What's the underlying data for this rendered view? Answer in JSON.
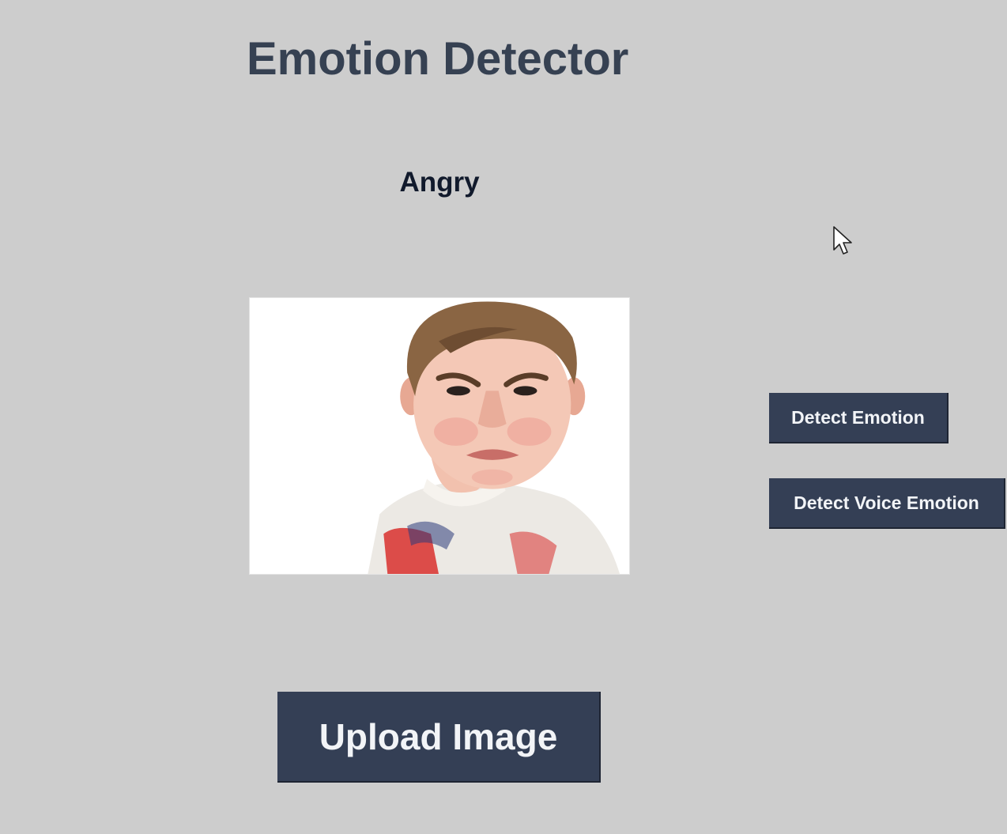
{
  "app": {
    "title": "Emotion Detector"
  },
  "result": {
    "emotion_label": "Angry"
  },
  "preview": {
    "icon": "uploaded-photo-icon"
  },
  "actions": {
    "detect_emotion_label": "Detect Emotion",
    "detect_voice_emotion_label": "Detect Voice Emotion",
    "upload_image_label": "Upload Image"
  },
  "colors": {
    "background": "#cdcdcd",
    "title": "#364152",
    "button": "#343f55",
    "button_text": "#f2f4f7"
  },
  "cursor": {
    "icon": "mouse-pointer-icon"
  }
}
